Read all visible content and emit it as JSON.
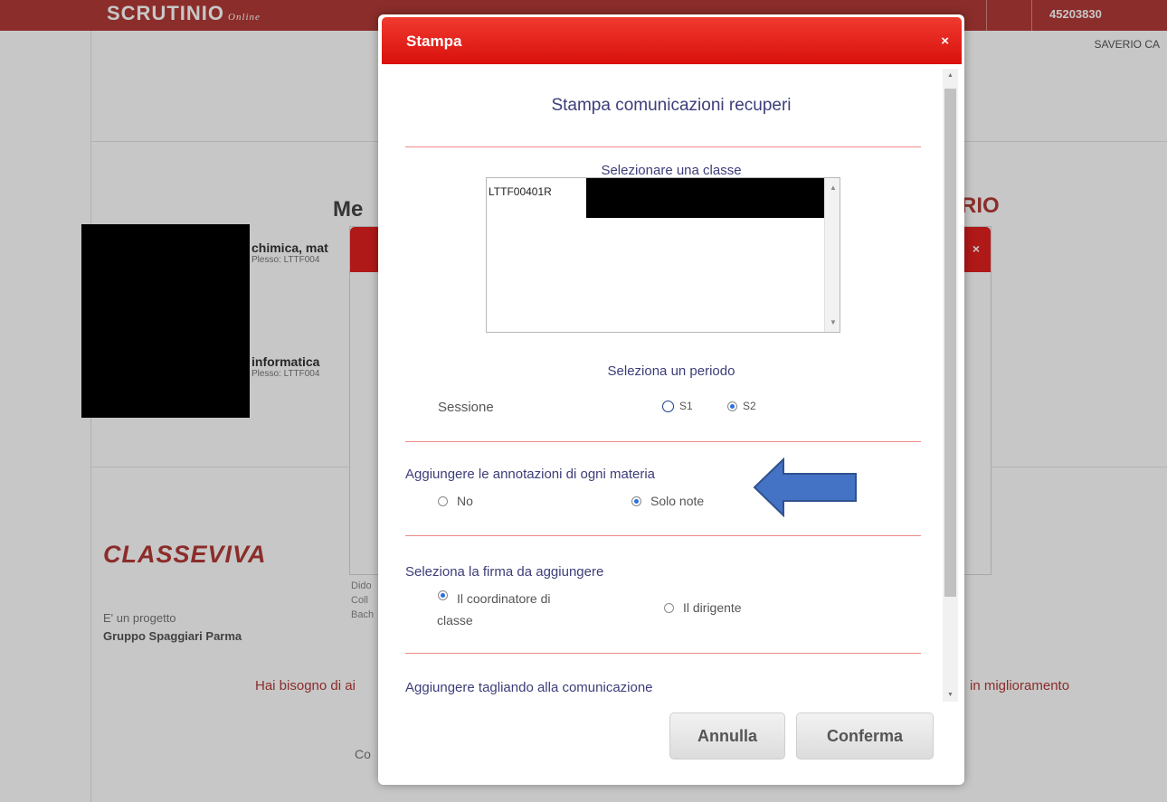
{
  "background": {
    "brand": "SCRUTINIO",
    "brand_sub": "Online",
    "user_name": "SAVERIO CA",
    "topbar_number": "45203830",
    "menu_title_left": "Me",
    "menu_title_right": "RIO",
    "items": [
      {
        "name": "chimica, mat",
        "plesso": "Plesso: LTTF004"
      },
      {
        "name": "informatica",
        "plesso": "Plesso: LTTF004"
      }
    ],
    "logo": "CLASSEVIVA",
    "project_text": "E' un progetto",
    "group_text": "Gruppo Spaggiari Parma",
    "help_left": "Hai bisogno di ai",
    "help_right": "in miglioramento",
    "co_text": "Co",
    "small_texts": [
      "Dido",
      "Coll",
      "Bach"
    ]
  },
  "modal": {
    "title": "Stampa",
    "close_label": "×",
    "heading": "Stampa comunicazioni recuperi",
    "class_label": "Selezionare una classe",
    "class_option": "LTTF00401R",
    "period_label": "Seleziona un periodo",
    "session_label": "Sessione",
    "session_options": [
      "S1",
      "S2"
    ],
    "session_selected": "S2",
    "annotations_label": "Aggiungere le annotazioni di ogni materia",
    "annotation_options": [
      "No",
      "Solo note"
    ],
    "annotation_selected": "Solo note",
    "signature_label": "Seleziona la firma da aggiungere",
    "signature_option_1_line1": "Il coordinatore di",
    "signature_option_1_line2": "classe",
    "signature_option_2": "Il dirigente",
    "signature_selected": "Il coordinatore di classe",
    "coupon_label": "Aggiungere tagliando alla comunicazione",
    "cancel_label": "Annulla",
    "confirm_label": "Conferma"
  },
  "colors": {
    "header_red": "#e0201f",
    "text_blue": "#3d3d7a",
    "arrow_blue": "#4472c4"
  }
}
